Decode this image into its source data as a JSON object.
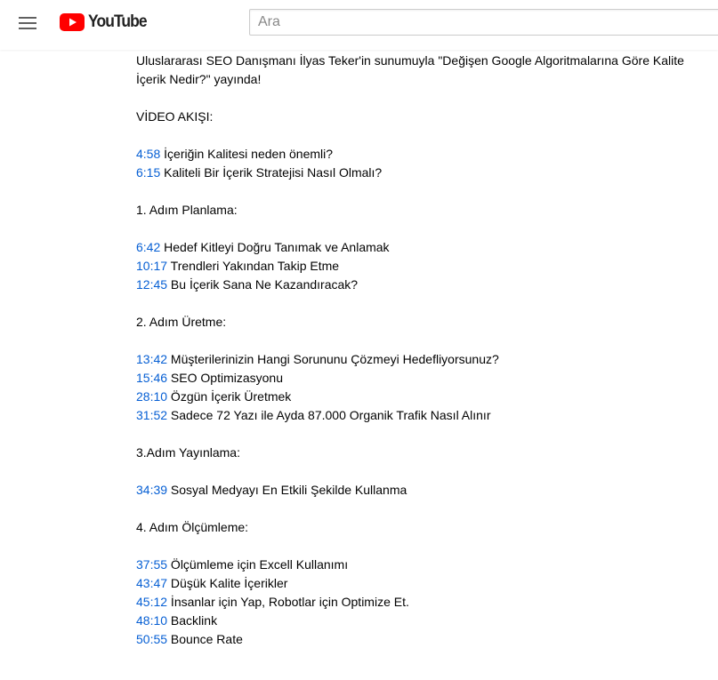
{
  "header": {
    "logo_text": "YouTube",
    "search_placeholder": "Ara",
    "brand_color": "#FF0000"
  },
  "description": {
    "intro_line1": "Uluslararası SEO Danışmanı İlyas Teker'in sunumuyla \"Değişen Google Algoritmalarına Göre Kalite",
    "intro_line2": "İçerik Nedir?\" yayında!",
    "flow_title": "VİDEO AKIŞI:",
    "sections": [
      {
        "items": [
          {
            "time": "4:58",
            "text": " İçeriğin Kalitesi neden önemli?"
          },
          {
            "time": "6:15",
            "text": " Kaliteli Bir İçerik Stratejisi Nasıl Olmalı?"
          }
        ]
      },
      {
        "title": "1. Adım Planlama:",
        "items": [
          {
            "time": "6:42",
            "text": " Hedef Kitleyi Doğru Tanımak ve Anlamak"
          },
          {
            "time": "10:17",
            "text": " Trendleri Yakından Takip Etme"
          },
          {
            "time": "12:45",
            "text": " Bu İçerik Sana Ne Kazandıracak?"
          }
        ]
      },
      {
        "title": "2. Adım Üretme:",
        "items": [
          {
            "time": "13:42",
            "text": " Müşterilerinizin Hangi Sorununu Çözmeyi Hedefliyorsunuz?"
          },
          {
            "time": "15:46",
            "text": " SEO Optimizasyonu"
          },
          {
            "time": "28:10",
            "text": " Özgün İçerik Üretmek"
          },
          {
            "time": "31:52",
            "text": " Sadece 72 Yazı ile Ayda 87.000 Organik Trafik Nasıl Alınır"
          }
        ]
      },
      {
        "title": "3.Adım Yayınlama:",
        "items": [
          {
            "time": "34:39",
            "text": " Sosyal Medyayı En Etkili Şekilde Kullanma"
          }
        ]
      },
      {
        "title": "4. Adım Ölçümleme:",
        "items": [
          {
            "time": "37:55",
            "text": " Ölçümleme için Excell Kullanımı"
          },
          {
            "time": "43:47",
            "text": " Düşük Kalite İçerikler"
          },
          {
            "time": "45:12",
            "text": " İnsanlar için Yap, Robotlar için Optimize Et."
          },
          {
            "time": "48:10",
            "text": " Backlink"
          },
          {
            "time": "50:55",
            "text": " Bounce Rate"
          }
        ]
      }
    ]
  }
}
